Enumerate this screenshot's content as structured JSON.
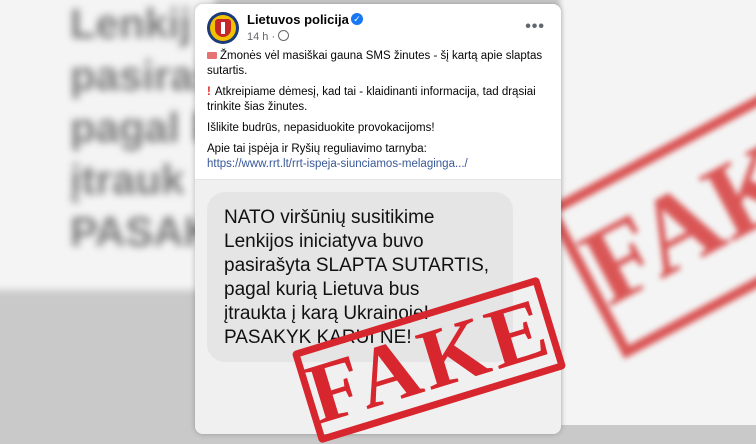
{
  "page": {
    "name": "Lietuvos policija",
    "time": "14 h"
  },
  "post": {
    "line1": "Žmonės vėl masiškai gauna SMS žinutes - šį kartą apie slaptas sutartis.",
    "line2": "Atkreipiame dėmesį, kad tai - klaidinanti informacija, tad drąsiai trinkite šias žinutes.",
    "line3": "Išlikite budrūs, nepasiduokite provokacijoms!",
    "line4": "Apie tai įspėja ir Ryšių reguliavimo tarnyba:",
    "link": "https://www.rrt.lt/rrt-ispeja-siunciamos-melaginga.../"
  },
  "sms": {
    "text": "NATO viršūnių susitikime\nLenkijos iniciatyva buvo\npasirašyta SLAPTA SUTARTIS,\npagal kurią Lietuva bus\nįtraukta į karą Ukrainoje!\nPASAKYK KARUI NE!"
  },
  "stamp": {
    "label": "FAKE",
    "color": "#d8262e"
  },
  "background_blur_lines": [
    "Lenkij",
    "pasiraš",
    "pagal k",
    "įtrauk",
    "PASAK"
  ],
  "icons": {
    "verified": "verified-badge-icon",
    "privacy": "globe-icon",
    "menu": "more-options-icon",
    "sms": "sms-icon",
    "warning": "exclamation-icon"
  }
}
